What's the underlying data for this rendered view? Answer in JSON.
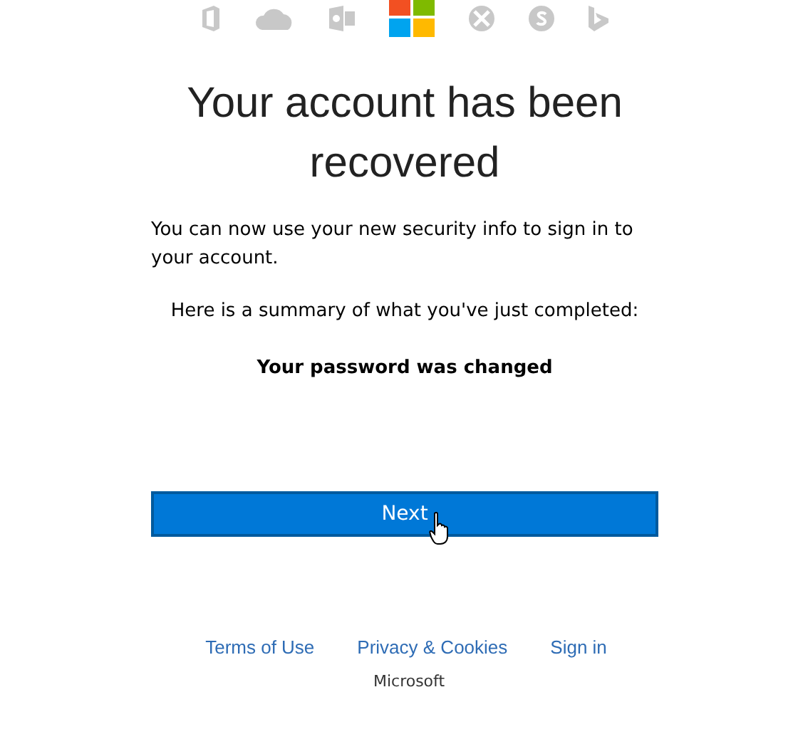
{
  "heading": "Your account has been recovered",
  "message": "You can now use your new security info to sign in to your account.",
  "summary_intro": "Here is a summary of what you've just completed:",
  "summary_item": "Your password was changed",
  "next_button": "Next",
  "footer_links": [
    "Terms of Use",
    "Privacy & Cookies",
    "Sign in"
  ],
  "footer_brand": "Microsoft"
}
